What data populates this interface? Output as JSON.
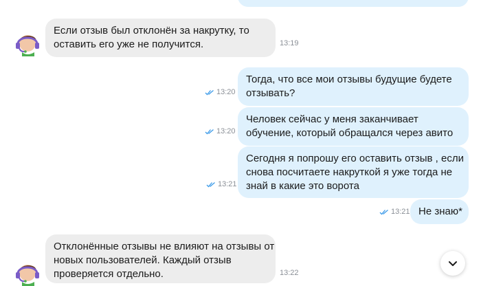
{
  "messages": [
    {
      "lines": [
        "Если отзыв был отклонён за накрутку, то",
        "оставить его уже не получится."
      ],
      "time": "13:19",
      "direction": "incoming",
      "avatar": "support-agent-headset-icon"
    },
    {
      "lines": [
        "Тогда, что все мои отзывы будущие будете",
        "отзывать?"
      ],
      "time": "13:20",
      "direction": "outgoing",
      "read": true
    },
    {
      "lines": [
        "Человек сейчас у меня заканчивает",
        "обучение, который обращался через авито"
      ],
      "time": "13:20",
      "direction": "outgoing",
      "read": true
    },
    {
      "lines": [
        "Сегодня я попрошу его оставить отзыв , если",
        "снова посчитаете накруткой я уже тогда не",
        "знай в какие это ворота"
      ],
      "time": "13:21",
      "direction": "outgoing",
      "read": true
    },
    {
      "lines": [
        "Не знаю*"
      ],
      "time": "13:21",
      "direction": "outgoing",
      "read": true
    },
    {
      "lines": [
        "Отклонённые отзывы не влияют на отзывы от",
        "новых пользователей. Каждый отзыв",
        "проверяется отдельно."
      ],
      "time": "13:22",
      "direction": "incoming",
      "avatar": "support-agent-headset-icon"
    }
  ],
  "icons": {
    "read_receipt": "double-check-icon",
    "scroll_down": "chevron-down-icon"
  },
  "colors": {
    "incoming_bubble": "#ededed",
    "outgoing_bubble": "#dff1fd",
    "read_tick": "#3d9be9",
    "timestamp": "#8a8f96"
  }
}
